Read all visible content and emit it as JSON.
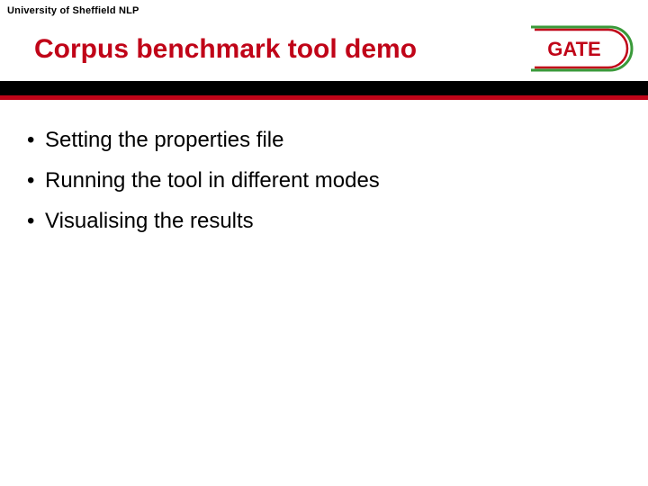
{
  "affiliation": "University of Sheffield NLP",
  "title": "Corpus benchmark tool demo",
  "logo_text": "GATE",
  "colors": {
    "brand_red": "#c00418",
    "logo_green": "#3a9a3a"
  },
  "bullets": [
    "Setting the properties file",
    "Running the tool in different modes",
    "Visualising the results"
  ]
}
